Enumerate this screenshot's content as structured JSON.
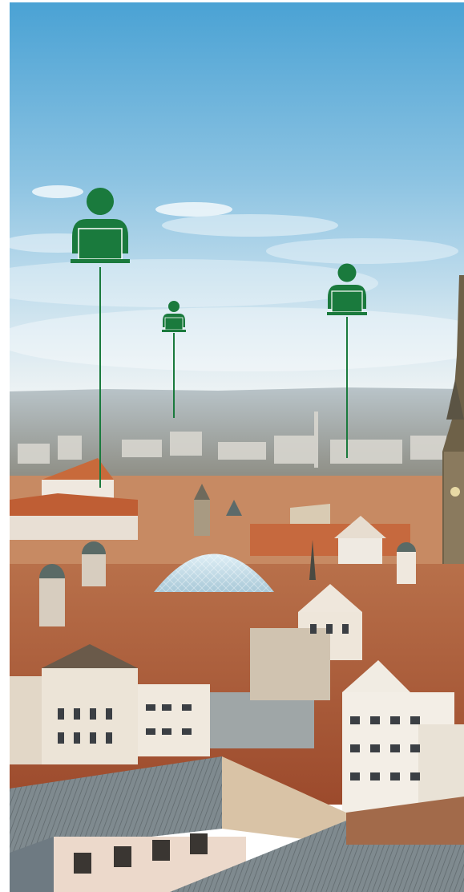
{
  "scene": {
    "description_icons": [
      {
        "icon": "person-at-laptop-icon"
      },
      {
        "icon": "person-at-laptop-icon"
      },
      {
        "icon": "person-at-laptop-icon"
      }
    ],
    "colors": {
      "pin_green": "#1a7a3d",
      "sky_top": "#4ea6d6",
      "sky_horizon": "#e9f2f6",
      "roof_orange": "#c8643a"
    }
  }
}
